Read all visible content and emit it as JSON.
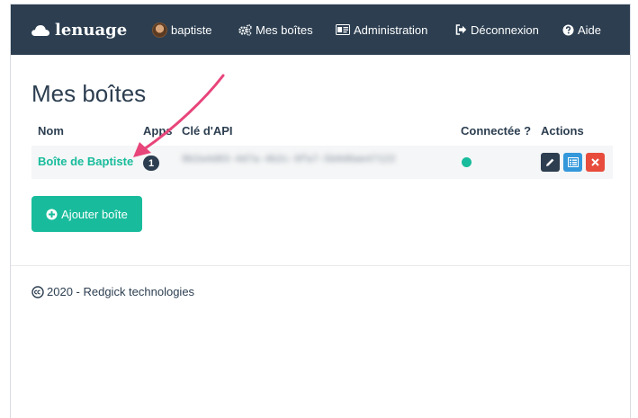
{
  "navbar": {
    "brand": "lenuage",
    "user": "baptiste",
    "my_boxes": "Mes boîtes",
    "admin": "Administration",
    "logout": "Déconnexion",
    "help": "Aide",
    "background_color": "#2c3e50"
  },
  "page": {
    "title": "Mes boîtes"
  },
  "table": {
    "headers": {
      "name": "Nom",
      "apps": "Apps",
      "api_key": "Clé d'API",
      "connected": "Connectée ?",
      "actions": "Actions"
    },
    "rows": [
      {
        "name": "Boîte de Baptiste",
        "apps_count": "1",
        "api_key_masked": "9b2a4d83-4d7a-4b2c-9fa7-5b0d6ae47122",
        "connected": true
      }
    ]
  },
  "buttons": {
    "add_box": "Ajouter boîte"
  },
  "footer": {
    "text": "2020 - Redgick technologies"
  },
  "colors": {
    "accent": "#18bc9c",
    "primary": "#2c3e50",
    "info": "#3498db",
    "danger": "#e74c3c",
    "annotation_arrow": "#e8457a"
  }
}
